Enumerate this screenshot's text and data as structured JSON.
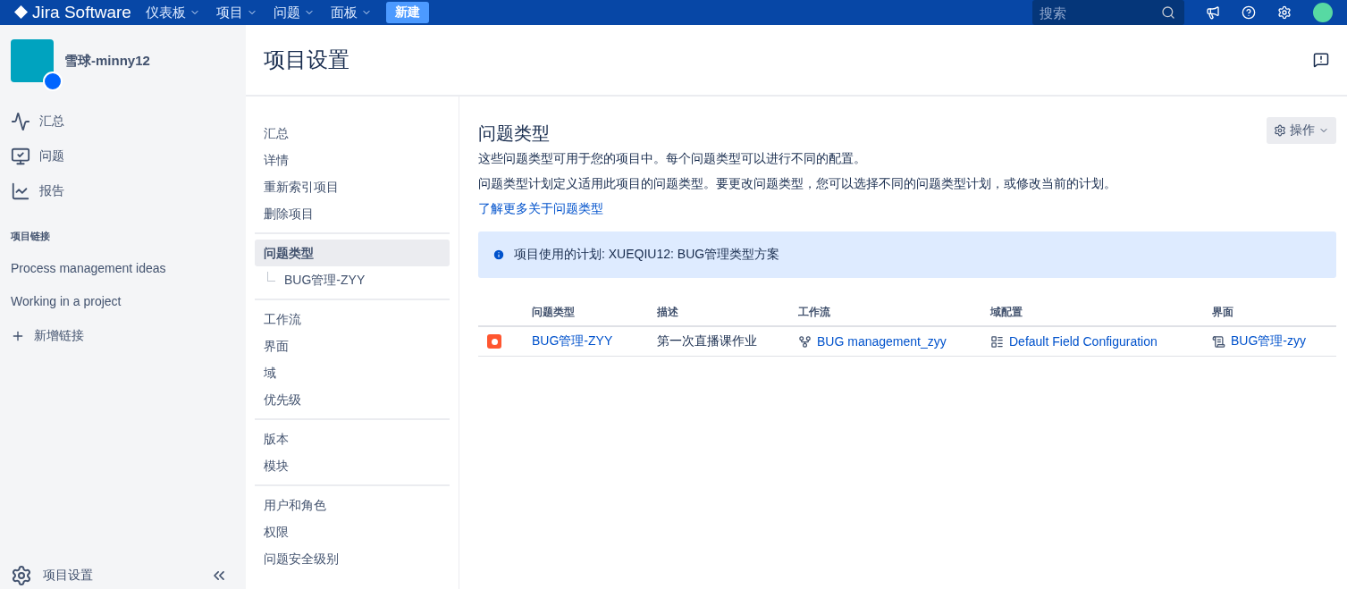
{
  "top_bar": {
    "logo": "Jira Software",
    "menus": [
      {
        "label": "仪表板"
      },
      {
        "label": "项目"
      },
      {
        "label": "问题"
      },
      {
        "label": "面板"
      }
    ],
    "create_button": "新建",
    "search": {
      "placeholder": "搜索"
    }
  },
  "sidebar": {
    "project_name": "雪球-minny12",
    "items": [
      {
        "label": "汇总"
      },
      {
        "label": "问题"
      },
      {
        "label": "报告"
      }
    ],
    "links_heading": "项目链接",
    "links": [
      "Process management ideas",
      "Working in a project"
    ],
    "add_link": "新增链接",
    "footer": "项目设置"
  },
  "page_title": "项目设置",
  "settings_nav": [
    [
      {
        "label": "汇总",
        "selected": false
      },
      {
        "label": "详情",
        "selected": false
      },
      {
        "label": "重新索引项目",
        "selected": false
      },
      {
        "label": "删除项目",
        "selected": false
      }
    ],
    [
      {
        "label": "问题类型",
        "selected": true,
        "children": [
          {
            "label": "BUG管理-ZYY",
            "selected": false
          }
        ]
      }
    ],
    [
      {
        "label": "工作流",
        "selected": false
      },
      {
        "label": "界面",
        "selected": false
      },
      {
        "label": "域",
        "selected": false
      },
      {
        "label": "优先级",
        "selected": false
      }
    ],
    [
      {
        "label": "版本",
        "selected": false
      },
      {
        "label": "模块",
        "selected": false
      }
    ],
    [
      {
        "label": "用户和角色",
        "selected": false
      },
      {
        "label": "权限",
        "selected": false
      },
      {
        "label": "问题安全级别",
        "selected": false
      }
    ]
  ],
  "content": {
    "title": "问题类型",
    "actions_button": "操作",
    "paragraphs": [
      "这些问题类型可用于您的项目中。每个问题类型可以进行不同的配置。",
      "问题类型计划定义适用此项目的问题类型。要更改问题类型，您可以选择不同的问题类型计划，或修改当前的计划。"
    ],
    "learn_more": "了解更多关于问题类型",
    "info": "项目使用的计划: XUEQIU12: BUG管理类型方案",
    "table": {
      "columns": [
        "问题类型",
        "描述",
        "工作流",
        "域配置",
        "界面"
      ],
      "rows": [
        {
          "issue_type": "BUG管理-ZYY",
          "description": "第一次直播课作业",
          "workflow": "BUG management_zyy",
          "field_configuration": "Default Field Configuration",
          "screen": "BUG管理-zyy"
        }
      ]
    }
  }
}
